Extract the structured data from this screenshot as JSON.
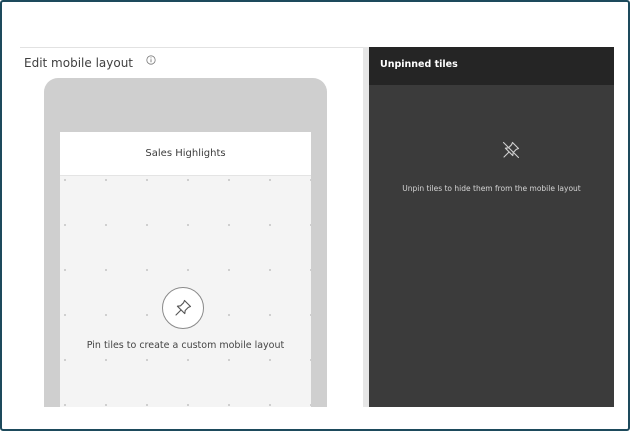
{
  "editor": {
    "title": "Edit mobile layout",
    "info_icon": "info-circle-icon"
  },
  "phone": {
    "dashboard_name": "Sales Highlights",
    "pin_icon": "pin-icon",
    "empty_hint": "Pin tiles to create a custom mobile layout"
  },
  "unpinned": {
    "title": "Unpinned tiles",
    "unpin_icon": "unpin-icon",
    "empty_hint": "Unpin tiles to hide them from the mobile layout"
  },
  "colors": {
    "frame_border": "#1d4a5c",
    "phone_body": "#cfcfcf",
    "unpinned_bg": "#3b3b3b",
    "unpinned_header_bg": "#252525"
  }
}
